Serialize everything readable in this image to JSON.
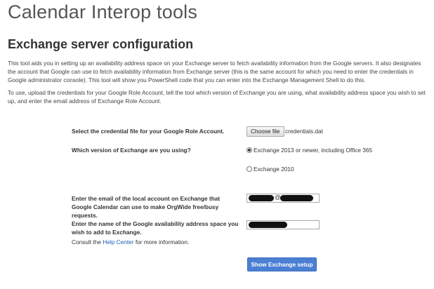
{
  "app_title": "Calendar Interop tools",
  "section_title": "Exchange server configuration",
  "description": {
    "paragraph1": "This tool aids you in setting up an availability address space on your Exchange server to fetch availability information from the Google servers. It also designates the account that Google can use to fetch availability information from Exchange server (this is the same account for which you need to enter the credentials in Google administrator console). This tool will show you PowerShell code that you can enter into the Exchange Management Shell to do this.",
    "paragraph2": "To use, upload the credentials for your Google Role Account, tell the tool which version of Exchange you are using, what availability address space you wish to set up, and enter the email address of Exchange Role Account."
  },
  "form": {
    "credential_label": "Select the credential file for your Google Role Account.",
    "choose_file_label": "Choose file",
    "file_name": "credentials.dat",
    "version_label": "Which version of Exchange are you using?",
    "version_options": [
      {
        "label": "Exchange 2013 or newer, including Office 365",
        "selected": true
      },
      {
        "label": "Exchange 2010",
        "selected": false
      }
    ],
    "email_label": "Enter the email of the local account on Exchange that Google Calendar can use to make OrgWide free/busy requests.",
    "email_at": "@",
    "space_label": "Enter the name of the Google availability address space you wish to add to Exchange.",
    "hint_prefix": "Consult the ",
    "hint_link": "Help Center",
    "hint_suffix": " for more information.",
    "submit_label": "Show Exchange setup"
  },
  "colors": {
    "primary_button": "#4a7fd4",
    "link": "#1a5fb4"
  }
}
